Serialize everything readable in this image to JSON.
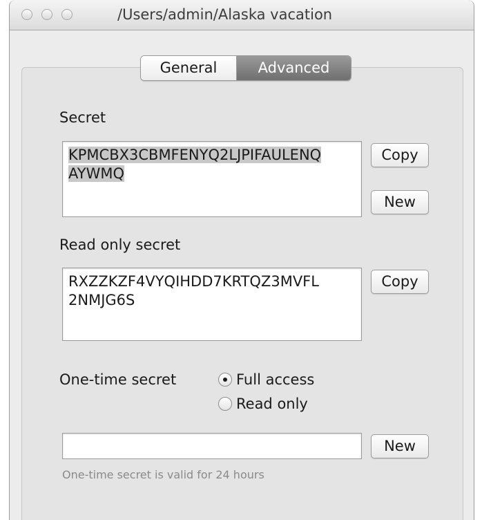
{
  "window": {
    "title": "/Users/admin/Alaska vacation"
  },
  "tabs": [
    {
      "label": "General",
      "selected": false
    },
    {
      "label": "Advanced",
      "selected": true
    }
  ],
  "secret": {
    "label": "Secret",
    "value_lines": [
      "KPMCBX3CBMFENYQ2LJPIFAULENQ",
      "AYWMQ"
    ],
    "copy_label": "Copy",
    "new_label": "New"
  },
  "read_only_secret": {
    "label": "Read only secret",
    "value_lines": [
      "RXZZKZF4VYQIHDD7KRTQZ3MVFL",
      "2NMJG6S"
    ],
    "copy_label": "Copy"
  },
  "one_time": {
    "label": "One-time secret",
    "options": [
      {
        "label": "Full access",
        "selected": true
      },
      {
        "label": "Read only",
        "selected": false
      }
    ],
    "input_value": "",
    "new_label": "New",
    "hint": "One-time secret is valid for 24 hours"
  }
}
